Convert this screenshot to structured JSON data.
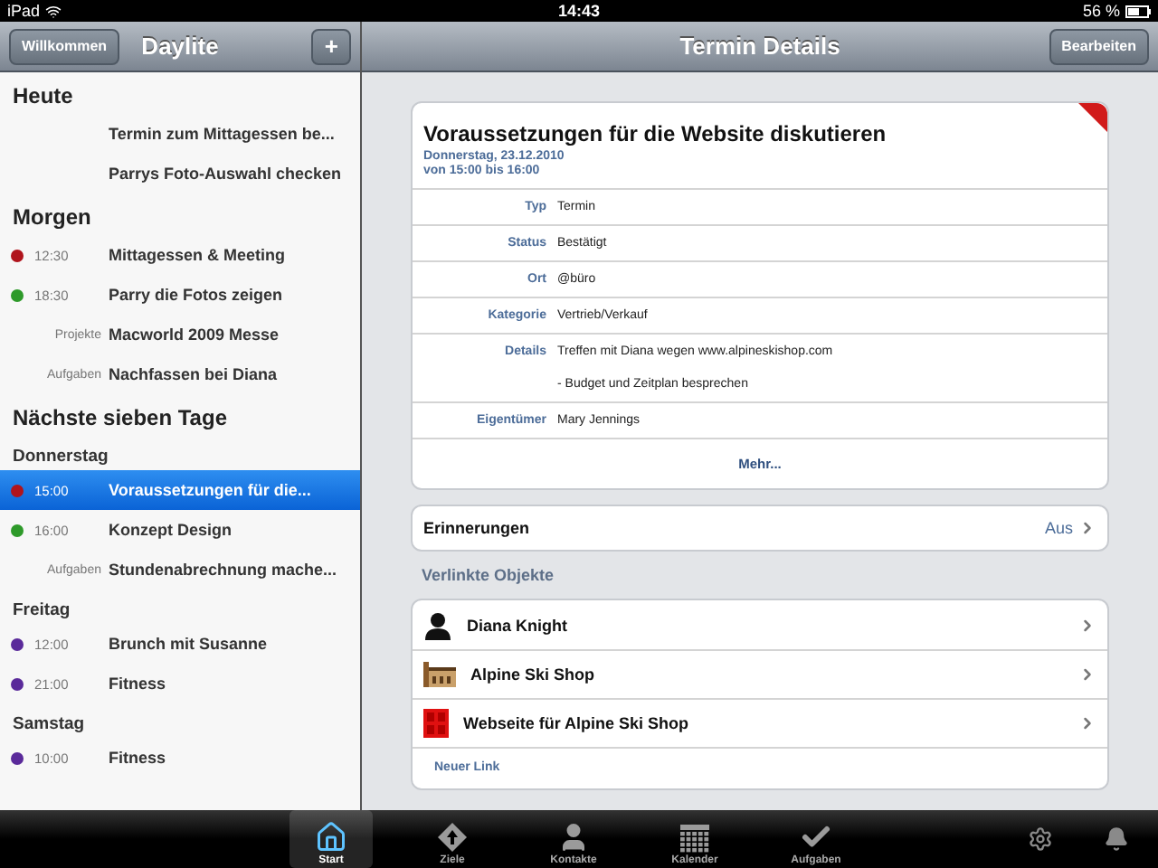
{
  "status_bar": {
    "device": "iPad",
    "time": "14:43",
    "battery": "56 %"
  },
  "sidebar": {
    "back_button": "Willkommen",
    "title": "Daylite",
    "add_button": "+",
    "sections": [
      {
        "title": "Heute",
        "groups": [
          {
            "rows": [
              {
                "kind": "plain",
                "text": "Termin zum Mittagessen be...",
                "selected": false
              },
              {
                "kind": "plain",
                "text": "Parrys Foto-Auswahl checken",
                "selected": false
              }
            ]
          }
        ]
      },
      {
        "title": "Morgen",
        "groups": [
          {
            "rows": [
              {
                "kind": "timed",
                "time": "12:30",
                "color": "#b0141c",
                "text": "Mittagessen & Meeting",
                "selected": false
              },
              {
                "kind": "timed",
                "time": "18:30",
                "color": "#2e9a2a",
                "text": "Parry die Fotos zeigen",
                "selected": false
              },
              {
                "kind": "labeled",
                "label": "Projekte",
                "text": "Macworld 2009 Messe",
                "selected": false
              },
              {
                "kind": "labeled",
                "label": "Aufgaben",
                "text": "Nachfassen bei Diana",
                "selected": false
              }
            ]
          }
        ]
      },
      {
        "title": "Nächste sieben Tage",
        "groups": [
          {
            "day": "Donnerstag",
            "rows": [
              {
                "kind": "timed",
                "time": "15:00",
                "color": "#b0141c",
                "text": "Voraussetzungen für die...",
                "selected": true
              },
              {
                "kind": "timed",
                "time": "16:00",
                "color": "#2e9a2a",
                "text": "Konzept Design",
                "selected": false
              },
              {
                "kind": "labeled",
                "label": "Aufgaben",
                "text": "Stundenabrechnung mache...",
                "selected": false
              }
            ]
          },
          {
            "day": "Freitag",
            "rows": [
              {
                "kind": "timed",
                "time": "12:00",
                "color": "#5a2a9a",
                "text": "Brunch mit Susanne",
                "selected": false
              },
              {
                "kind": "timed",
                "time": "21:00",
                "color": "#5a2a9a",
                "text": "Fitness",
                "selected": false
              }
            ]
          },
          {
            "day": "Samstag",
            "rows": [
              {
                "kind": "timed",
                "time": "10:00",
                "color": "#5a2a9a",
                "text": "Fitness",
                "selected": false
              }
            ]
          }
        ]
      }
    ]
  },
  "detail": {
    "title": "Termin Details",
    "edit_button": "Bearbeiten",
    "event": {
      "title": "Voraussetzungen für die Website diskutieren",
      "date": "Donnerstag, 23.12.2010",
      "time": "von 15:00 bis 16:00",
      "flagged": true,
      "fields": [
        {
          "label": "Typ",
          "lines": [
            "Termin"
          ]
        },
        {
          "label": "Status",
          "lines": [
            "Bestätigt"
          ]
        },
        {
          "label": "Ort",
          "lines": [
            "@büro"
          ]
        },
        {
          "label": "Kategorie",
          "lines": [
            "Vertrieb/Verkauf"
          ]
        },
        {
          "label": "Details",
          "lines": [
            "Treffen mit Diana wegen www.alpineskishop.com",
            "- Budget und Zeitplan besprechen"
          ]
        },
        {
          "label": "Eigentümer",
          "lines": [
            "Mary Jennings"
          ]
        }
      ],
      "more": "Mehr..."
    },
    "reminders": {
      "label": "Erinnerungen",
      "value": "Aus"
    },
    "linked_title": "Verlinkte Objekte",
    "linked": [
      {
        "kind": "person",
        "name": "Diana Knight"
      },
      {
        "kind": "company",
        "name": "Alpine Ski Shop"
      },
      {
        "kind": "project",
        "name": "Webseite für Alpine Ski Shop"
      }
    ],
    "new_link": "Neuer Link"
  },
  "tab_bar": {
    "tabs": [
      {
        "kind": "home",
        "label": "Start",
        "selected": true
      },
      {
        "kind": "goals",
        "label": "Ziele",
        "selected": false
      },
      {
        "kind": "contacts",
        "label": "Kontakte",
        "selected": false
      },
      {
        "kind": "calendar",
        "label": "Kalender",
        "selected": false
      },
      {
        "kind": "tasks",
        "label": "Aufgaben",
        "selected": false
      }
    ]
  }
}
